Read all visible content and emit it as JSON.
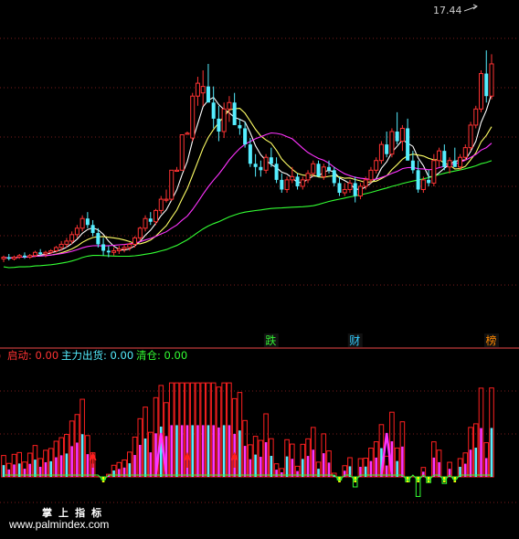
{
  "chart_data": [
    {
      "type": "candlestick",
      "panel": "price",
      "grid": true,
      "grid_style": "dashed-red",
      "annotations": {
        "high_label": "17.44",
        "badges": [
          {
            "text": "跌",
            "color": "#33ee33",
            "bar": 51
          },
          {
            "text": "财",
            "color": "#33ccff",
            "bar": 67
          },
          {
            "text": "榜",
            "color": "#ff8800",
            "bar": 93
          }
        ]
      },
      "series_colors": {
        "up": "#ff3333",
        "down": "#55eeff",
        "ma_fast": "#ffffff",
        "ma_mid": "#ffff66",
        "ma_slow": "#ff33ff",
        "ma_long": "#33ff33"
      },
      "ylim": [
        1,
        20
      ],
      "candles": [
        [
          4.5,
          4.7,
          4.3,
          4.6
        ],
        [
          4.6,
          4.8,
          4.4,
          4.5
        ],
        [
          4.5,
          4.7,
          4.4,
          4.6
        ],
        [
          4.6,
          4.8,
          4.5,
          4.7
        ],
        [
          4.7,
          4.9,
          4.5,
          4.6
        ],
        [
          4.6,
          4.8,
          4.5,
          4.7
        ],
        [
          4.7,
          5.0,
          4.6,
          4.9
        ],
        [
          4.9,
          5.1,
          4.7,
          4.8
        ],
        [
          4.8,
          5.0,
          4.6,
          4.9
        ],
        [
          4.9,
          5.1,
          4.8,
          5.0
        ],
        [
          5.0,
          5.3,
          4.9,
          5.2
        ],
        [
          5.2,
          5.6,
          5.0,
          5.4
        ],
        [
          5.4,
          5.8,
          5.2,
          5.6
        ],
        [
          5.6,
          6.2,
          5.4,
          6.0
        ],
        [
          6.0,
          6.6,
          5.8,
          6.4
        ],
        [
          6.4,
          7.2,
          6.2,
          7.0
        ],
        [
          7.0,
          7.4,
          6.4,
          6.6
        ],
        [
          6.6,
          6.9,
          5.9,
          6.1
        ],
        [
          6.1,
          6.4,
          5.2,
          5.4
        ],
        [
          5.4,
          5.8,
          4.7,
          5.0
        ],
        [
          5.0,
          5.3,
          4.6,
          4.9
        ],
        [
          4.9,
          5.2,
          4.7,
          5.0
        ],
        [
          5.0,
          5.3,
          4.8,
          5.1
        ],
        [
          5.1,
          5.4,
          4.9,
          5.2
        ],
        [
          5.2,
          5.5,
          5.0,
          5.4
        ],
        [
          5.4,
          5.9,
          5.2,
          5.8
        ],
        [
          5.8,
          6.5,
          5.6,
          6.4
        ],
        [
          6.4,
          7.2,
          6.2,
          7.0
        ],
        [
          7.0,
          7.4,
          6.6,
          6.8
        ],
        [
          6.8,
          7.6,
          6.6,
          7.5
        ],
        [
          7.5,
          8.4,
          7.3,
          8.2
        ],
        [
          8.2,
          8.8,
          8.0,
          8.2
        ],
        [
          8.2,
          10.0,
          8.1,
          10.0
        ],
        [
          10.0,
          10.2,
          9.9,
          10.0
        ],
        [
          10.0,
          12.2,
          10.0,
          12.2
        ],
        [
          12.3,
          12.4,
          12.2,
          12.3
        ],
        [
          12.0,
          14.8,
          11.8,
          14.6
        ],
        [
          14.6,
          15.8,
          14.0,
          15.4
        ],
        [
          14.8,
          16.2,
          14.0,
          15.2
        ],
        [
          15.2,
          16.6,
          14.6,
          14.2
        ],
        [
          14.2,
          15.2,
          12.6,
          13.2
        ],
        [
          13.2,
          14.0,
          11.8,
          12.4
        ],
        [
          12.4,
          14.2,
          12.0,
          13.8
        ],
        [
          13.8,
          14.6,
          13.0,
          14.2
        ],
        [
          14.2,
          14.8,
          12.8,
          12.8
        ],
        [
          12.8,
          13.2,
          12.2,
          12.6
        ],
        [
          12.6,
          13.0,
          11.4,
          11.6
        ],
        [
          11.6,
          12.0,
          10.2,
          10.4
        ],
        [
          10.4,
          11.0,
          9.6,
          10.2
        ],
        [
          10.2,
          10.6,
          9.6,
          10.0
        ],
        [
          10.0,
          11.0,
          9.8,
          10.8
        ],
        [
          10.8,
          11.4,
          10.2,
          10.4
        ],
        [
          10.4,
          10.8,
          9.2,
          9.4
        ],
        [
          9.4,
          9.8,
          8.6,
          8.8
        ],
        [
          8.8,
          9.6,
          8.6,
          9.4
        ],
        [
          9.4,
          10.2,
          9.2,
          9.6
        ],
        [
          9.6,
          9.8,
          8.8,
          9.0
        ],
        [
          9.0,
          9.6,
          8.8,
          9.4
        ],
        [
          9.4,
          10.0,
          9.2,
          9.8
        ],
        [
          9.8,
          10.6,
          9.6,
          10.4
        ],
        [
          10.4,
          10.6,
          9.6,
          9.6
        ],
        [
          9.6,
          10.4,
          9.4,
          10.2
        ],
        [
          10.2,
          10.6,
          9.8,
          10.0
        ],
        [
          10.0,
          10.2,
          9.0,
          9.2
        ],
        [
          9.2,
          9.6,
          8.4,
          8.6
        ],
        [
          8.6,
          9.2,
          8.4,
          8.8
        ],
        [
          8.8,
          9.4,
          8.6,
          9.2
        ],
        [
          9.2,
          9.6,
          8.0,
          8.4
        ],
        [
          8.4,
          9.2,
          8.2,
          9.0
        ],
        [
          9.0,
          9.6,
          8.8,
          9.4
        ],
        [
          9.4,
          10.2,
          9.2,
          10.0
        ],
        [
          10.0,
          10.8,
          9.8,
          10.6
        ],
        [
          10.6,
          11.8,
          10.4,
          11.6
        ],
        [
          11.6,
          12.4,
          10.8,
          11.0
        ],
        [
          11.0,
          12.6,
          10.8,
          12.4
        ],
        [
          12.4,
          13.6,
          11.6,
          11.8
        ],
        [
          11.8,
          12.8,
          11.2,
          12.6
        ],
        [
          12.6,
          13.2,
          10.6,
          10.6
        ],
        [
          10.6,
          11.2,
          9.8,
          10.0
        ],
        [
          10.0,
          10.6,
          8.6,
          8.8
        ],
        [
          8.8,
          9.6,
          8.6,
          9.4
        ],
        [
          9.4,
          10.0,
          9.0,
          9.2
        ],
        [
          9.2,
          11.0,
          9.0,
          10.6
        ],
        [
          10.6,
          11.4,
          10.2,
          11.2
        ],
        [
          11.2,
          11.6,
          10.0,
          10.2
        ],
        [
          10.2,
          10.8,
          9.8,
          10.6
        ],
        [
          10.6,
          11.4,
          10.2,
          10.2
        ],
        [
          10.2,
          11.0,
          10.0,
          10.8
        ],
        [
          10.8,
          11.6,
          10.6,
          11.4
        ],
        [
          11.4,
          13.0,
          11.2,
          12.8
        ],
        [
          12.8,
          14.0,
          12.6,
          13.8
        ],
        [
          13.8,
          16.2,
          13.6,
          16.0
        ],
        [
          16.0,
          17.44,
          14.2,
          14.6
        ],
        [
          14.6,
          17.2,
          14.4,
          16.6
        ]
      ]
    },
    {
      "type": "bar",
      "panel": "indicator",
      "legend": [
        {
          "label": "启动: 0.00",
          "color": "#ff3333"
        },
        {
          "label": "主力出货: 0.00",
          "color": "#55eeff"
        },
        {
          "label": "清仓: 0.00",
          "color": "#33ff33"
        }
      ],
      "ylim": [
        -1,
        1.3
      ],
      "series_colors": {
        "up": "#ff2020",
        "magenta": "#ff33ff",
        "cyan": "#55eeff",
        "yellow": "#ffff00",
        "down": "#33ff33",
        "arrow": "#ff2020",
        "spike": "#ff33ff"
      }
    }
  ],
  "watermark": {
    "line1": "掌 上 指 标",
    "line2": "www.palmindex.com"
  }
}
